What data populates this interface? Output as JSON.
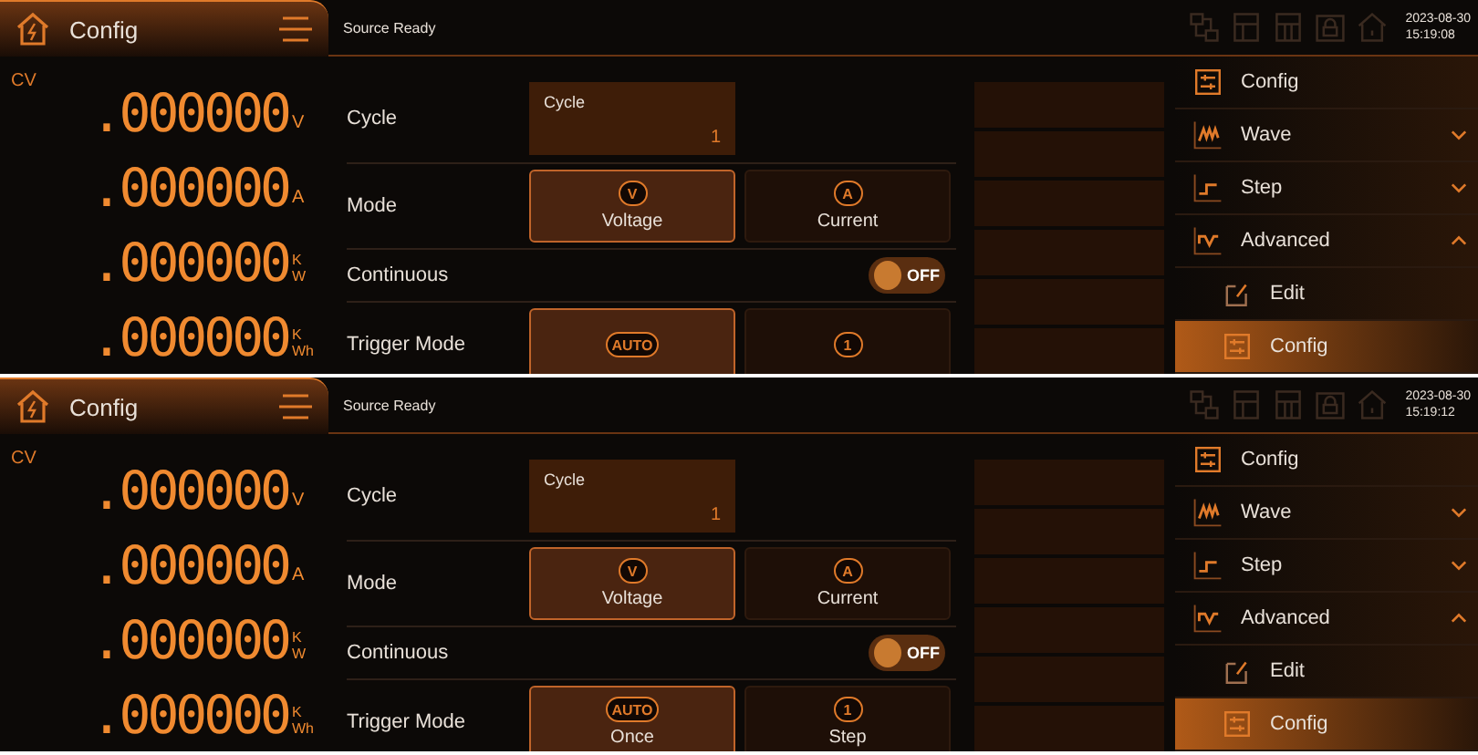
{
  "screens": [
    {
      "header": {
        "title": "Config",
        "status": "Source Ready",
        "date": "2023-08-30",
        "time": "15:19:08"
      },
      "mode": "CV",
      "readings": [
        {
          "value": ".000000",
          "unit": "V"
        },
        {
          "value": ".000000",
          "unit": "A"
        },
        {
          "value": ".000000",
          "unit_top": "K",
          "unit_bottom": "W"
        },
        {
          "value": ".000000",
          "unit_top": "K",
          "unit_bottom": "Wh"
        }
      ],
      "settings": [
        {
          "kind": "field",
          "label": "Cycle",
          "field_label": "Cycle",
          "value": "1"
        },
        {
          "kind": "options",
          "label": "Mode",
          "options": [
            {
              "icon": "V",
              "label": "Voltage",
              "selected": true
            },
            {
              "icon": "A",
              "label": "Current",
              "selected": false
            }
          ]
        },
        {
          "kind": "toggle",
          "label": "Continuous",
          "on": false,
          "text": "OFF"
        },
        {
          "kind": "options",
          "label": "Trigger Mode",
          "options": [
            {
              "icon": "AUTO",
              "selected": true
            },
            {
              "icon": "1",
              "selected": false
            }
          ]
        }
      ],
      "menu": [
        {
          "kind": "top",
          "label": "Config",
          "selected": false
        },
        {
          "kind": "group",
          "label": "Wave",
          "expanded": false,
          "selected": false
        },
        {
          "kind": "group",
          "label": "Step",
          "expanded": false,
          "selected": false
        },
        {
          "kind": "group",
          "label": "Advanced",
          "expanded": true,
          "selected": false
        },
        {
          "kind": "sub",
          "label": "Edit",
          "selected": false
        },
        {
          "kind": "sub",
          "label": "Config",
          "selected": true
        }
      ]
    },
    {
      "header": {
        "title": "Config",
        "status": "Source Ready",
        "date": "2023-08-30",
        "time": "15:19:12"
      },
      "mode": "CV",
      "readings": [
        {
          "value": ".000000",
          "unit": "V"
        },
        {
          "value": ".000000",
          "unit": "A"
        },
        {
          "value": ".000000",
          "unit_top": "K",
          "unit_bottom": "W"
        },
        {
          "value": ".000000",
          "unit_top": "K",
          "unit_bottom": "Wh"
        }
      ],
      "settings": [
        {
          "kind": "field",
          "label": "Cycle",
          "field_label": "Cycle",
          "value": "1"
        },
        {
          "kind": "options",
          "label": "Mode",
          "options": [
            {
              "icon": "V",
              "label": "Voltage",
              "selected": true
            },
            {
              "icon": "A",
              "label": "Current",
              "selected": false
            }
          ]
        },
        {
          "kind": "toggle",
          "label": "Continuous",
          "on": false,
          "text": "OFF"
        },
        {
          "kind": "options",
          "label": "Trigger Mode",
          "options": [
            {
              "icon": "AUTO",
              "label": "Once",
              "selected": true
            },
            {
              "icon": "1",
              "label": "Step",
              "selected": false
            }
          ]
        }
      ],
      "menu": [
        {
          "kind": "top",
          "label": "Config",
          "selected": false
        },
        {
          "kind": "group",
          "label": "Wave",
          "expanded": false,
          "selected": false
        },
        {
          "kind": "group",
          "label": "Step",
          "expanded": false,
          "selected": false
        },
        {
          "kind": "group",
          "label": "Advanced",
          "expanded": true,
          "selected": false
        },
        {
          "kind": "sub",
          "label": "Edit",
          "selected": false
        },
        {
          "kind": "sub",
          "label": "Config",
          "selected": true
        }
      ]
    }
  ]
}
